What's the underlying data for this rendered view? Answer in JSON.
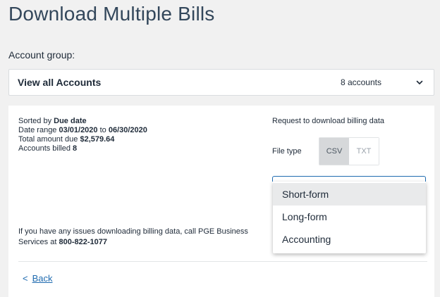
{
  "page": {
    "title": "Download Multiple Bills"
  },
  "account_group": {
    "label": "Account group:",
    "selected": "View all Accounts",
    "count": "8 accounts",
    "chevron_icon": "chevron-down-icon"
  },
  "summary": {
    "sorted_prefix": "Sorted by ",
    "sorted_value": "Due date",
    "range_prefix": "Date range ",
    "range_start": "03/01/2020",
    "range_sep": " to ",
    "range_end": "06/30/2020",
    "total_prefix": "Total amount due ",
    "total_value": "$2,579.64",
    "billed_prefix": "Accounts billed ",
    "billed_value": "8"
  },
  "download": {
    "request_label": "Request to download billing data",
    "file_type_label": "File type",
    "file_types": [
      "CSV",
      "TXT"
    ],
    "selected_file_type": "CSV"
  },
  "format_menu": {
    "items": [
      "Short-form",
      "Long-form",
      "Accounting"
    ],
    "highlighted": "Short-form"
  },
  "help": {
    "text": "If you have any issues downloading billing data, call PGE Business Services at ",
    "phone": "800-822-1077"
  },
  "nav": {
    "back_icon": "<",
    "back_label": "Back"
  },
  "colors": {
    "link": "#1f6bb0",
    "background": "#f1f1f1",
    "panel": "#ffffff",
    "toggle_active": "#d6d8da"
  }
}
